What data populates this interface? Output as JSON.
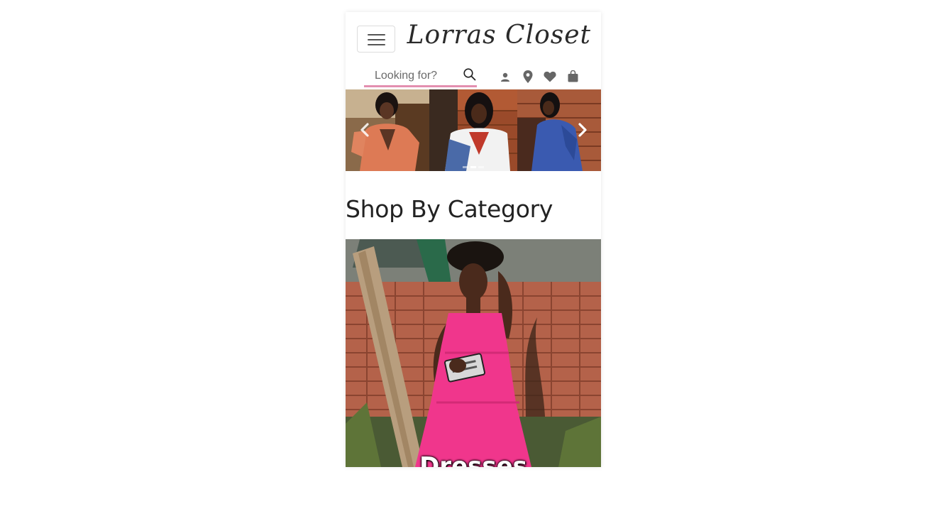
{
  "header": {
    "brand": "Lorras Closet",
    "menu_icon": "hamburger-icon"
  },
  "search": {
    "placeholder": "Looking for?",
    "value": "",
    "icon": "search-icon"
  },
  "nav_icons": [
    {
      "name": "account-icon"
    },
    {
      "name": "location-icon"
    },
    {
      "name": "heart-icon"
    },
    {
      "name": "shopping-bag-icon"
    }
  ],
  "carousel": {
    "prev_icon": "chevron-left-icon",
    "next_icon": "chevron-right-icon",
    "slide_count": 3,
    "active_index": 1
  },
  "section": {
    "title": "Shop By Category"
  },
  "categories": [
    {
      "label": "Dresses"
    }
  ],
  "colors": {
    "accent_pink": "#e38fb0",
    "text_dark": "#222222"
  }
}
